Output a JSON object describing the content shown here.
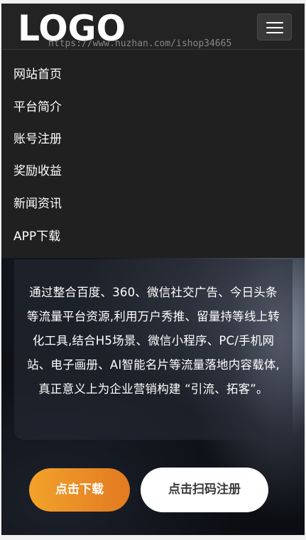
{
  "header": {
    "logo_text": "LOGO",
    "watermark": "https://www.huzhan.com/ishop34665"
  },
  "nav": {
    "items": [
      {
        "label": "网站首页"
      },
      {
        "label": "平台简介"
      },
      {
        "label": "账号注册"
      },
      {
        "label": "奖励收益"
      },
      {
        "label": "新闻资讯"
      },
      {
        "label": "APP下载"
      }
    ]
  },
  "intro": {
    "text": "通过整合百度、360、微信社交广告、今日头条等流量平台资源,利用万户秀推、留量持等线上转化工具,结合H5场景、微信小程序、PC/手机网站、电子画册、AI智能名片等流量落地内容载体,真正意义上为企业营销构建 “引流、拓客”。"
  },
  "buttons": {
    "download": "点击下载",
    "register": "点击扫码注册"
  },
  "colors": {
    "header_bg": "#232323",
    "nav_bg": "#202020",
    "accent_orange": "#e88a25",
    "button_white": "#ffffff"
  }
}
